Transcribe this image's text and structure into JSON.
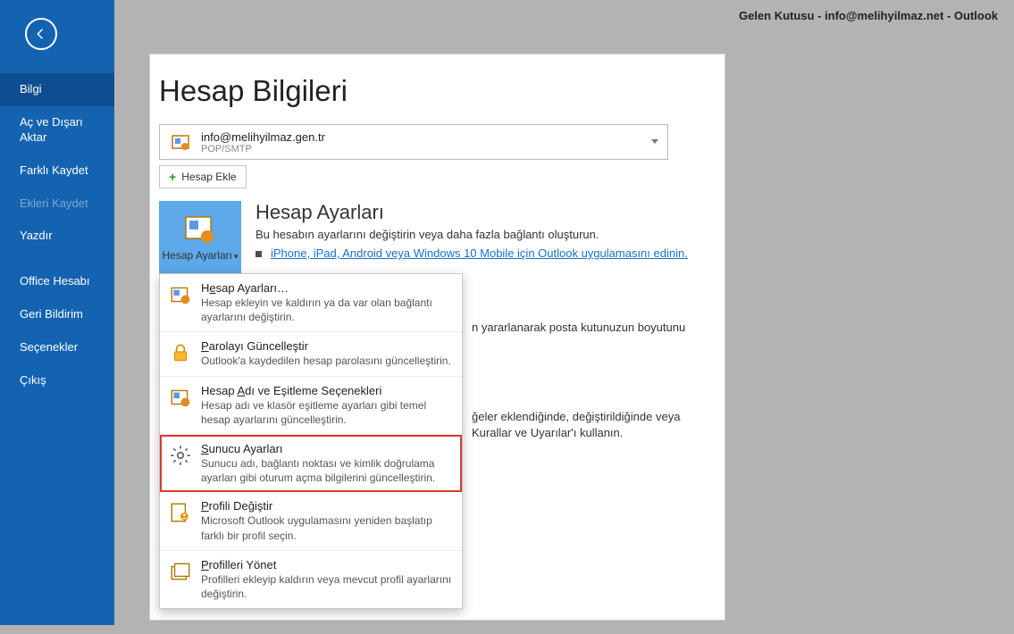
{
  "window_title": "Gelen Kutusu - info@melihyilmaz.net  -  Outlook",
  "nav": {
    "items": [
      {
        "label": "Bilgi",
        "active": true
      },
      {
        "label": "Aç ve Dışarı Aktar"
      },
      {
        "label": "Farklı Kaydet"
      },
      {
        "label": "Ekleri Kaydet",
        "disabled": true
      },
      {
        "label": "Yazdır"
      },
      {
        "sep": true
      },
      {
        "label": "Office Hesabı"
      },
      {
        "label": "Geri Bildirim"
      },
      {
        "label": "Seçenekler"
      },
      {
        "label": "Çıkış"
      }
    ]
  },
  "page_title": "Hesap Bilgileri",
  "account": {
    "email": "info@melihyilmaz.gen.tr",
    "type": "POP/SMTP"
  },
  "add_account_label": "Hesap Ekle",
  "settings_section": {
    "button_label": "Hesap Ayarları",
    "title": "Hesap Ayarları",
    "desc": "Bu hesabın ayarlarını değiştirin veya daha fazla bağlantı oluşturun.",
    "link": "iPhone, iPad, Android veya Windows 10 Mobile için Outlook uygulamasını edinin."
  },
  "bg_snip1": "n yararlanarak posta kutunuzun boyutunu",
  "bg_snip2a": "ğeler eklendiğinde, değiştirildiğinde veya",
  "bg_snip2b": "Kurallar ve Uyarılar'ı kullanın.",
  "menu": [
    {
      "title_pre": "H",
      "title_ul": "e",
      "title_post": "sap Ayarları…",
      "desc": "Hesap ekleyin ve kaldırın ya da var olan bağlantı ayarlarını değiştirin.",
      "icon": "account"
    },
    {
      "title_pre": "",
      "title_ul": "P",
      "title_post": "arolayı Güncelleştir",
      "desc": "Outlook'a kaydedilen hesap parolasını güncelleştirin.",
      "icon": "lock"
    },
    {
      "title_pre": "Hesap ",
      "title_ul": "A",
      "title_post": "dı ve Eşitleme Seçenekleri",
      "desc": "Hesap adı ve klasör eşitleme ayarları gibi temel hesap ayarlarını güncelleştirin.",
      "icon": "account"
    },
    {
      "title_pre": "",
      "title_ul": "S",
      "title_post": "unucu Ayarları",
      "desc": "Sunucu adı, bağlantı noktası ve kimlik doğrulama ayarları gibi oturum açma bilgilerini güncelleştirin.",
      "icon": "gear",
      "highlighted": true
    },
    {
      "title_pre": "",
      "title_ul": "P",
      "title_post": "rofili Değiştir",
      "desc": "Microsoft Outlook uygulamasını yeniden başlatıp farklı bir profil seçin.",
      "icon": "profile"
    },
    {
      "title_pre": "",
      "title_ul": "P",
      "title_post": "rofilleri Yönet",
      "desc": "Profilleri ekleyip kaldırın veya mevcut profil ayarlarını değiştirin.",
      "icon": "profiles"
    }
  ]
}
